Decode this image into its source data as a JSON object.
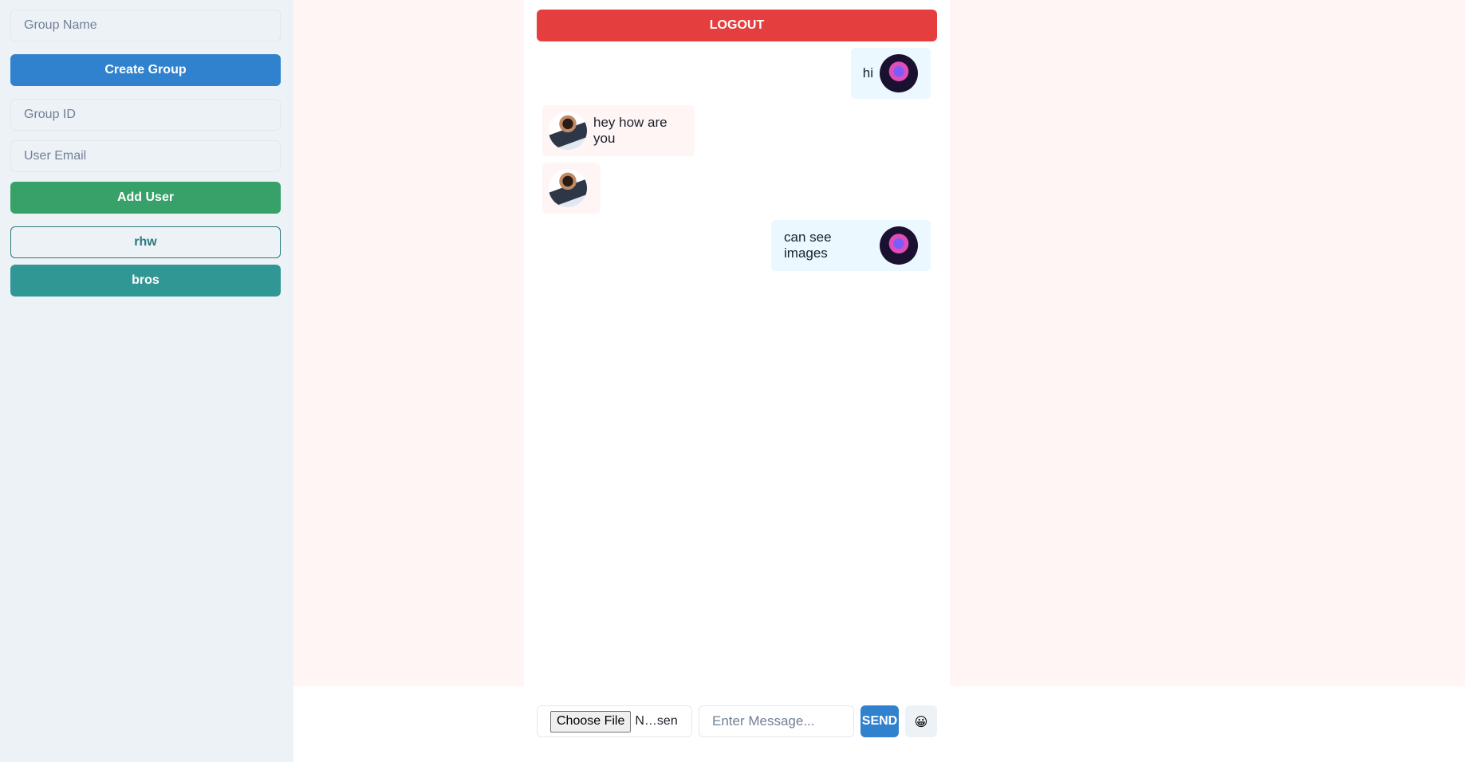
{
  "sidebar": {
    "group_name_placeholder": "Group Name",
    "create_group_label": "Create Group",
    "group_id_placeholder": "Group ID",
    "user_email_placeholder": "User Email",
    "add_user_label": "Add User",
    "groups": [
      {
        "label": "rhw",
        "selected": false
      },
      {
        "label": "bros",
        "selected": true
      }
    ]
  },
  "header": {
    "logout_label": "LOGOUT"
  },
  "messages": [
    {
      "text": "hi",
      "sender": "me",
      "avatar": "deity-avatar"
    },
    {
      "text": "hey how are you",
      "sender": "other",
      "avatar": "person-avatar"
    },
    {
      "text": "",
      "sender": "other",
      "avatar": "person-avatar"
    },
    {
      "text": "can see images",
      "sender": "me",
      "avatar": "deity-avatar"
    }
  ],
  "composer": {
    "file_button_label": "Choose File",
    "file_name": "N…sen",
    "message_placeholder": "Enter Message...",
    "send_label": "SEND",
    "emoji": "😀"
  },
  "colors": {
    "create_group": "#3182ce",
    "add_user": "#38a169",
    "group_selected": "#319795",
    "logout": "#e53e3e",
    "send": "#3182ce",
    "my_bubble": "#ebf8ff",
    "their_bubble": "#fff5f5"
  }
}
